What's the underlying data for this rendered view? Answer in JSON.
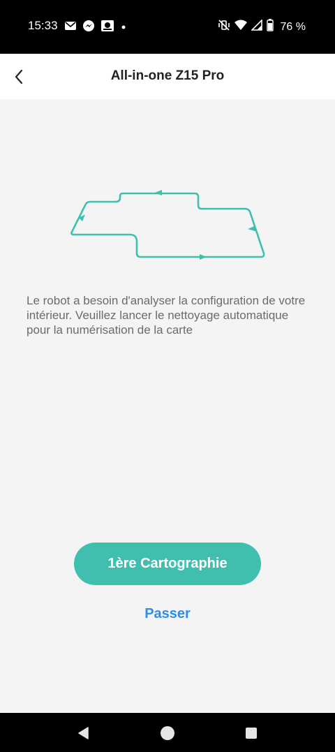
{
  "status_bar": {
    "time": "15:33",
    "battery_percent": "76 %",
    "icons": [
      "mail-icon",
      "messenger-icon",
      "camera-app-icon",
      "dot-icon",
      "vibrate-off-icon",
      "wifi-icon",
      "signal-icon",
      "battery-icon"
    ]
  },
  "header": {
    "title": "All-in-one Z15 Pro",
    "back_icon": "chevron-left-icon"
  },
  "illustration": {
    "icon": "cleaning-route-icon",
    "color": "#40bfae"
  },
  "main": {
    "description": "Le robot a besoin d'analyser la configuration de votre intérieur. Veuillez lancer le nettoyage automatique pour la numérisation de la carte",
    "primary_button": "1ère Cartographie",
    "skip_link": "Passer"
  },
  "colors": {
    "accent": "#40bfae",
    "link": "#2a8df0",
    "background": "#f4f4f4"
  },
  "nav_bar": {
    "icons": [
      "back-triangle-icon",
      "home-circle-icon",
      "recents-square-icon"
    ]
  }
}
